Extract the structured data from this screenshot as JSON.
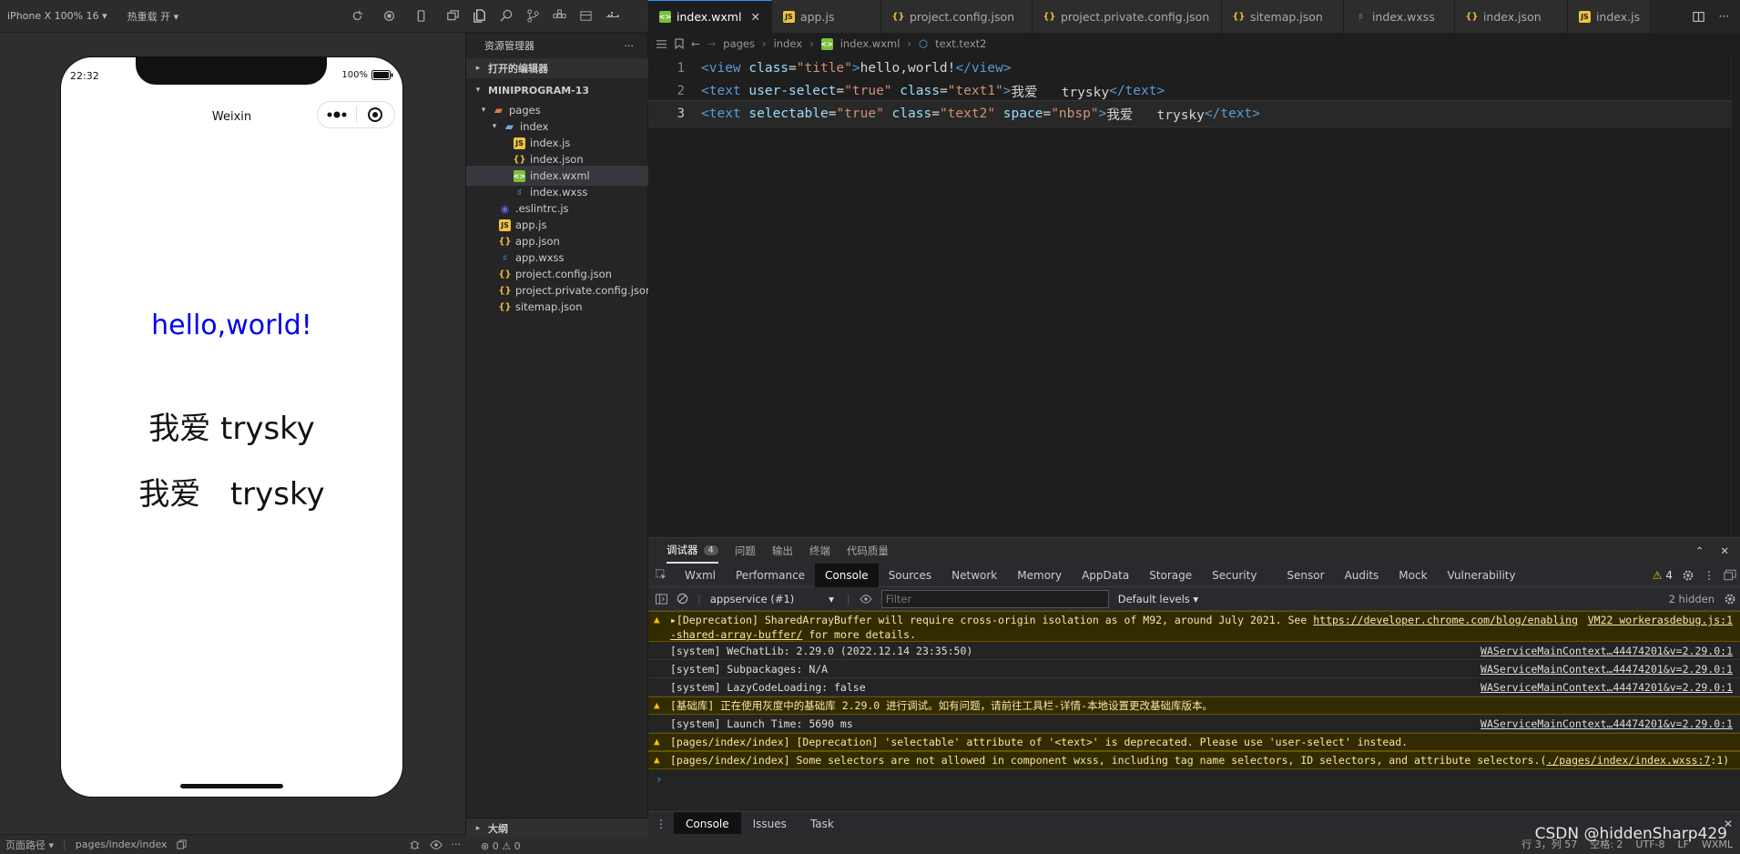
{
  "simulator": {
    "device": "iPhone X 100% 16",
    "hot_reload": "热重载 开",
    "phone": {
      "time": "22:32",
      "battery": "100%",
      "nav_title": "Weixin",
      "title_text": "hello,world!",
      "text1": "我爱 trysky",
      "text2": "我爱   trysky"
    },
    "footer": {
      "path_label": "页面路径",
      "path_value": "pages/index/index"
    }
  },
  "explorer": {
    "title": "资源管理器",
    "open_editors": "打开的编辑器",
    "project": "MINIPROGRAM-13",
    "tree": [
      {
        "label": "pages"
      },
      {
        "label": "index"
      },
      {
        "label": "index.js"
      },
      {
        "label": "index.json"
      },
      {
        "label": "index.wxml"
      },
      {
        "label": "index.wxss"
      },
      {
        "label": ".eslintrc.js"
      },
      {
        "label": "app.js"
      },
      {
        "label": "app.json"
      },
      {
        "label": "app.wxss"
      },
      {
        "label": "project.config.json"
      },
      {
        "label": "project.private.config.json"
      },
      {
        "label": "sitemap.json"
      }
    ],
    "outline": "大纲",
    "problems": "⊗ 0 ⚠ 0"
  },
  "editor": {
    "tabs": [
      {
        "label": "index.wxml"
      },
      {
        "label": "app.js"
      },
      {
        "label": "project.config.json"
      },
      {
        "label": "project.private.config.json"
      },
      {
        "label": "sitemap.json"
      },
      {
        "label": "index.wxss"
      },
      {
        "label": "index.json"
      },
      {
        "label": "index.js"
      }
    ],
    "breadcrumb": [
      "pages",
      "index",
      "index.wxml",
      "text.text2"
    ],
    "lines": [
      {
        "no": "1",
        "t1": "<view ",
        "a1": "class",
        "eq1": "=",
        "s1": "\"title\"",
        "t2": ">",
        "txt": "hello,world!",
        "t3": "</view>"
      },
      {
        "no": "2",
        "t1": "<text ",
        "a1": "user-select",
        "eq1": "=",
        "s1": "\"true\"",
        "a2": " class",
        "eq2": "=",
        "s2": "\"text1\"",
        "t2": ">",
        "txt": "我爱   trysky",
        "t3": "</text>"
      },
      {
        "no": "3",
        "t1": "<text ",
        "a1": "selectable",
        "eq1": "=",
        "s1": "\"true\"",
        "a2": " class",
        "eq2": "=",
        "s2": "\"text2\"",
        "a3": " space",
        "eq3": "=",
        "s3": "\"nbsp\"",
        "t2": ">",
        "txt": "我爱   trysky",
        "t3": "</text>"
      }
    ]
  },
  "devtools": {
    "top_tabs": {
      "debugger": "调试器",
      "debugger_count": "4",
      "problems": "问题",
      "output": "输出",
      "terminal": "终端",
      "quality": "代码质量"
    },
    "panels": [
      "Wxml",
      "Performance",
      "Console",
      "Sources",
      "Network",
      "Memory",
      "AppData",
      "Storage",
      "Security",
      "Sensor",
      "Audits",
      "Mock",
      "Vulnerability"
    ],
    "warn_count": "4",
    "context": "appservice (#1)",
    "filter_placeholder": "Filter",
    "levels": "Default levels",
    "hidden": "2 hidden",
    "messages": [
      {
        "text": "▸[Deprecation] SharedArrayBuffer will require cross-origin isolation as of M92, around July 2021. See ",
        "link": "https://developer.chrome.com/blog/enabling-shared-array-buffer/",
        "tail": " for more details.",
        "src": "VM22 workerasdebug.js:1"
      },
      {
        "text": "[system] WeChatLib: 2.29.0 (2022.12.14 23:35:50)",
        "src": "WAServiceMainContext…44474201&v=2.29.0:1"
      },
      {
        "text": "[system] Subpackages: N/A",
        "src": "WAServiceMainContext…44474201&v=2.29.0:1"
      },
      {
        "text": "[system] LazyCodeLoading: false",
        "src": "WAServiceMainContext…44474201&v=2.29.0:1"
      },
      {
        "text": "[基础库] 正在使用灰度中的基础库 2.29.0 进行调试。如有问题，请前往工具栏-详情-本地设置更改基础库版本。"
      },
      {
        "text": "[system] Launch Time: 5690 ms",
        "src": "WAServiceMainContext…44474201&v=2.29.0:1"
      },
      {
        "text": "[pages/index/index] [Deprecation] 'selectable' attribute of '<text>' is deprecated. Please use 'user-select' instead."
      },
      {
        "text": "[pages/index/index] Some selectors are not allowed in component wxss, including tag name selectors, ID selectors, and attribute selectors.(",
        "link": "./pages/index/index.wxss:7",
        "tail": ":1)"
      }
    ],
    "drawer": [
      "Console",
      "Issues",
      "Task"
    ]
  },
  "statusbar": {
    "position": "行 3，列 57",
    "spaces": "空格: 2",
    "encoding": "UTF-8",
    "eol": "LF",
    "lang": "WXML"
  },
  "watermark": "CSDN @hiddenSharp429"
}
